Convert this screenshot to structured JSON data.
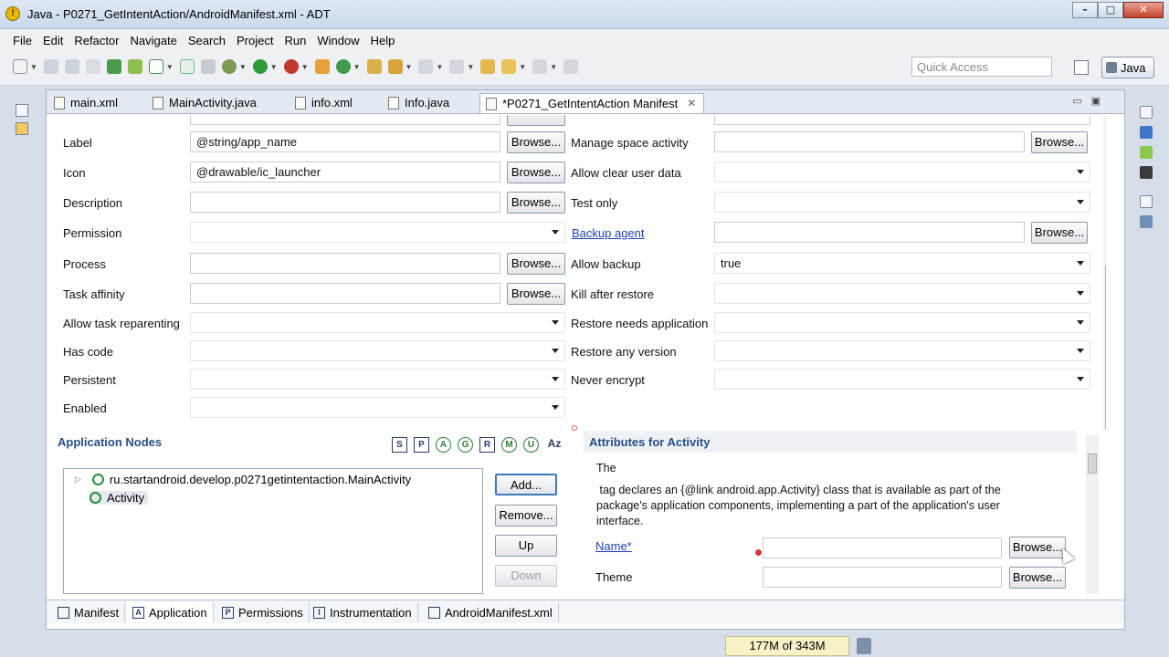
{
  "window": {
    "title": "Java - P0271_GetIntentAction/AndroidManifest.xml - ADT",
    "buttons": [
      "–",
      "□",
      "✕"
    ]
  },
  "menu": [
    "File",
    "Edit",
    "Refactor",
    "Navigate",
    "Search",
    "Project",
    "Run",
    "Window",
    "Help"
  ],
  "toolbar": {
    "quick_access_placeholder": "Quick Access",
    "perspective": "Java"
  },
  "editor_tabs": [
    {
      "label": "main.xml",
      "icon": "xml-file-icon"
    },
    {
      "label": "MainActivity.java",
      "icon": "java-file-icon"
    },
    {
      "label": "info.xml",
      "icon": "xml-file-icon"
    },
    {
      "label": "Info.java",
      "icon": "java-file-icon"
    },
    {
      "label": "*P0271_GetIntentAction Manifest",
      "icon": "manifest-icon",
      "active": true
    }
  ],
  "form": {
    "browse_label": "Browse...",
    "left": [
      {
        "label": "Label",
        "value": "@string/app_name",
        "kind": "text"
      },
      {
        "label": "Icon",
        "value": "@drawable/ic_launcher",
        "kind": "text"
      },
      {
        "label": "Description",
        "value": "",
        "kind": "text"
      },
      {
        "label": "Permission",
        "value": "",
        "kind": "combo"
      },
      {
        "label": "Process",
        "value": "",
        "kind": "text"
      },
      {
        "label": "Task affinity",
        "value": "",
        "kind": "text"
      },
      {
        "label": "Allow task reparenting",
        "value": "",
        "kind": "combo"
      },
      {
        "label": "Has code",
        "value": "",
        "kind": "combo"
      },
      {
        "label": "Persistent",
        "value": "",
        "kind": "combo"
      },
      {
        "label": "Enabled",
        "value": "",
        "kind": "combo"
      }
    ],
    "right": [
      {
        "label": "Manage space activity",
        "value": "",
        "kind": "text"
      },
      {
        "label": "Allow clear user data",
        "value": "",
        "kind": "combo"
      },
      {
        "label": "Test only",
        "value": "",
        "kind": "combo"
      },
      {
        "label": "Backup agent",
        "value": "",
        "kind": "text",
        "link": true
      },
      {
        "label": "Allow backup",
        "value": "true",
        "kind": "combo"
      },
      {
        "label": "Kill after restore",
        "value": "",
        "kind": "combo"
      },
      {
        "label": "Restore needs application",
        "value": "",
        "kind": "combo"
      },
      {
        "label": "Restore any version",
        "value": "",
        "kind": "combo"
      },
      {
        "label": "Never encrypt",
        "value": "",
        "kind": "combo"
      }
    ]
  },
  "application_nodes": {
    "title": "Application Nodes",
    "filter_icons": [
      "S",
      "P",
      "A",
      "G",
      "R",
      "M",
      "U",
      "Az"
    ],
    "tree": [
      {
        "label": "ru.startandroid.develop.p0271getintentaction.MainActivity",
        "expandable": true
      },
      {
        "label": "Activity",
        "expandable": false
      }
    ],
    "buttons": {
      "add": "Add...",
      "remove": "Remove...",
      "up": "Up",
      "down": "Down"
    }
  },
  "attributes": {
    "title": "Attributes for Activity",
    "line1": "The",
    "line2": " tag declares an {@link android.app.Activity} class that is available as part of the",
    "line3": "package's application components, implementing a part of the application's user",
    "line4": "interface.",
    "name_label": "Name*",
    "theme_label": "Theme",
    "browse_label": "Browse..."
  },
  "bottom_tabs": [
    {
      "label": "Manifest",
      "icon": "manifest-tab-icon"
    },
    {
      "label": "Application",
      "icon": "A",
      "active": true
    },
    {
      "label": "Permissions",
      "icon": "P"
    },
    {
      "label": "Instrumentation",
      "icon": "I"
    },
    {
      "label": "AndroidManifest.xml",
      "icon": "xml-file-icon"
    }
  ],
  "status": {
    "heap": "177M of 343M"
  }
}
